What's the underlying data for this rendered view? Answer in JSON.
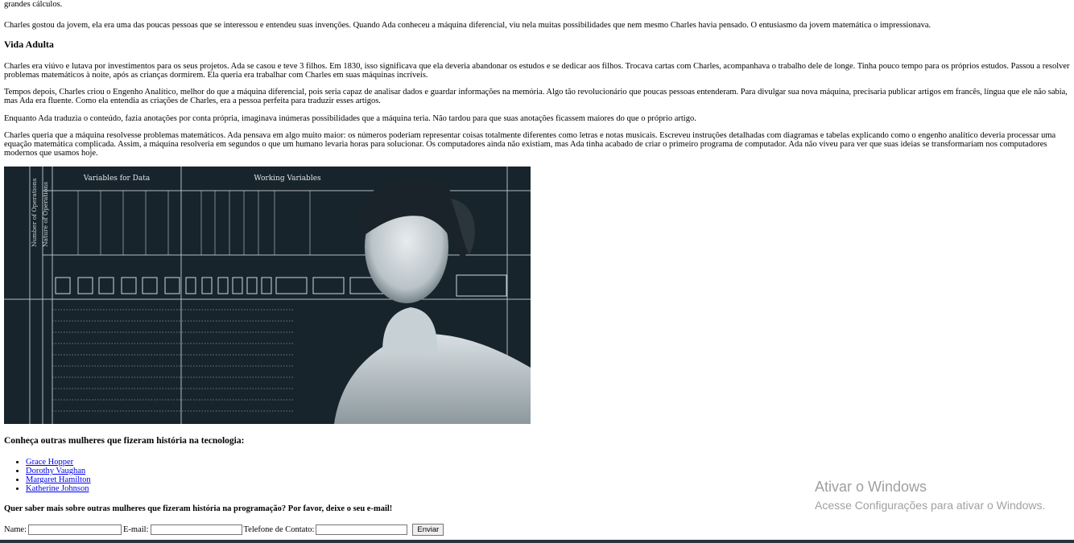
{
  "article": {
    "intro_tail": "grandes cálculos.",
    "p_charles_gostou": "Charles gostou da jovem, ela era uma das poucas pessoas que se interessou e entendeu suas invenções. Quando Ada conheceu a máquina diferencial, viu nela muitas possibilidades que nem mesmo Charles havia pensado. O entusiasmo da jovem matemática o impressionava.",
    "heading_vida_adulta": "Vida Adulta",
    "p_viuvo": "Charles era viúvo e lutava por investimentos para os seus projetos. Ada se casou e teve 3 filhos. Em 1830, isso significava que ela deveria abandonar os estudos e se dedicar aos filhos. Trocava cartas com Charles, acompanhava o trabalho dele de longe. Tinha pouco tempo para os próprios estudos. Passou a resolver problemas matemáticos à noite, após as crianças dormirem. Ela queria era trabalhar com Charles em suas máquinas incríveis.",
    "p_engenho": "Tempos depois, Charles criou o Engenho Analítico, melhor do que a máquina diferencial, pois seria capaz de analisar dados e guardar informações na memória. Algo tão revolucionário que poucas pessoas entenderam. Para divulgar sua nova máquina, precisaria publicar artigos em francês, língua que ele não sabia, mas Ada era fluente. Como ela entendia as criações de Charles, era a pessoa perfeita para traduzir esses artigos.",
    "p_traduzia": "Enquanto Ada traduzia o conteúdo, fazia anotações por conta própria, imaginava inúmeras possibilidades que a máquina teria. Não tardou para que suas anotações ficassem maiores do que o próprio artigo.",
    "p_queria": "Charles queria que a máquina resolvesse problemas matemáticos. Ada pensava em algo muito maior: os números poderiam representar coisas totalmente diferentes como letras e notas musicais. Escreveu instruções detalhadas com diagramas e tabelas explicando como o engenho analítico deveria processar uma equação matemática complicada. Assim, a máquina resolveria em segundos o que um humano levaria horas para solucionar. Os computadores ainda não existiam, mas Ada tinha acabado de criar o primeiro programa de computador. Ada não viveu para ver que suas ideias se transformariam nos computadores modernos que usamos hoje."
  },
  "figure": {
    "col_group_1": "Variables for Data",
    "col_group_2": "Working Variables",
    "side_label_1": "Number of Operations",
    "side_label_2": "Nature of Operations"
  },
  "more": {
    "heading": "Conheça outras mulheres que fizeram história na tecnologia:",
    "links": [
      "Grace Hopper",
      "Dorothy Vaughan",
      "Margaret Hamilton",
      "Katherine Johnson"
    ]
  },
  "form": {
    "cta": "Quer saber mais sobre outras mulheres que fizeram história na programação? Por favor, deixe o seu e-mail!",
    "name_label": "Name:",
    "email_label": "E-mail:",
    "phone_label": "Telefone de Contato:",
    "submit_label": "Enviar"
  },
  "watermark": {
    "title": "Ativar o Windows",
    "subtitle": "Acesse Configurações para ativar o Windows."
  },
  "colors": {
    "link": "#0000ee",
    "watermark": "#a0a0a0",
    "figure_bg": "#17242c",
    "taskbar": "#2b333d"
  }
}
